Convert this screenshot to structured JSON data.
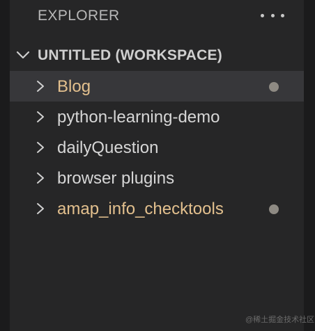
{
  "header": {
    "title": "EXPLORER",
    "more_icon": "ellipsis-icon"
  },
  "workspace": {
    "title": "UNTITLED (WORKSPACE)",
    "expanded": true
  },
  "folders": [
    {
      "label": "Blog",
      "modified": true,
      "selected": true
    },
    {
      "label": "python-learning-demo",
      "modified": false,
      "selected": false
    },
    {
      "label": "dailyQuestion",
      "modified": false,
      "selected": false
    },
    {
      "label": "browser plugins",
      "modified": false,
      "selected": false
    },
    {
      "label": "amap_info_checktools",
      "modified": true,
      "selected": false
    }
  ],
  "watermark": "@稀土掘金技术社区",
  "colors": {
    "modified_text": "#e3c08e",
    "selected_background": "#37373a",
    "panel_background": "#262627"
  }
}
